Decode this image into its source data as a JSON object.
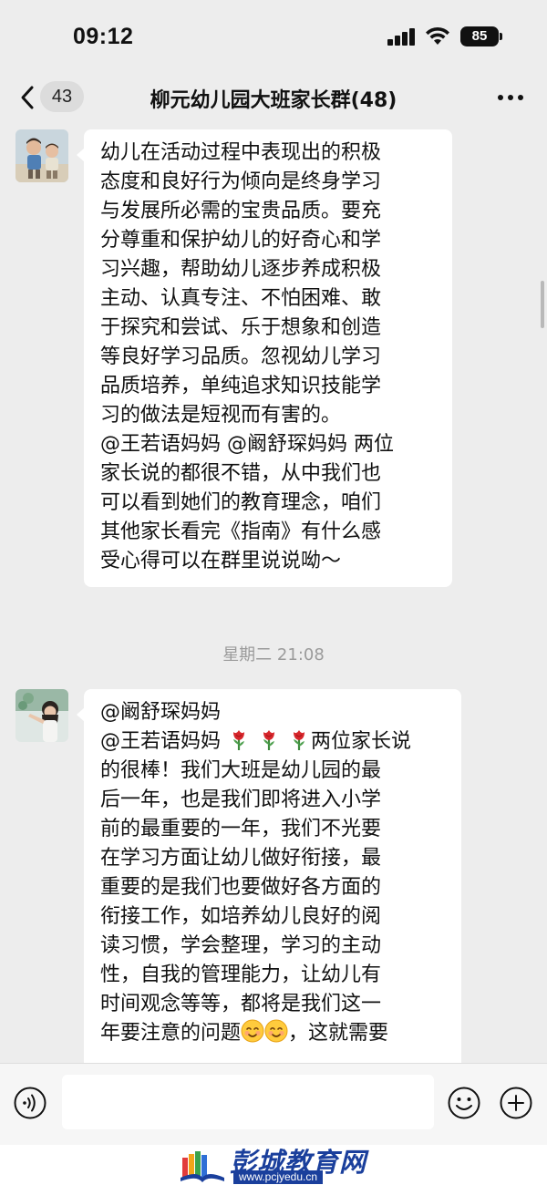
{
  "status_bar": {
    "time": "09:12",
    "battery": "85"
  },
  "nav": {
    "unread_count": "43",
    "title": "柳元幼儿园大班家长群(48)"
  },
  "messages": [
    {
      "avatar": "avatar-boys-photo",
      "text": "幼儿在活动过程中表现出的积极\n态度和良好行为倾向是终身学习\n与发展所必需的宝贵品质。要充\n分尊重和保护幼儿的好奇心和学\n习兴趣，帮助幼儿逐步养成积极\n主动、认真专注、不怕困难、敢\n于探究和尝试、乐于想象和创造\n等良好学习品质。忽视幼儿学习\n品质培养，单纯追求知识技能学\n习的做法是短视而有害的。\n@王若语妈妈 @阚舒琛妈妈 两位\n家长说的都很不错，从中我们也\n可以看到她们的教育理念，咱们\n其他家长看完《指南》有什么感\n受心得可以在群里说说呦～"
    },
    {
      "avatar": "avatar-girl-photo",
      "line1": "@阚舒琛妈妈",
      "line2_before": "@王若语妈妈 ",
      "line2_after": "两位家长说",
      "text_rest": "的很棒！我们大班是幼儿园的最\n后一年，也是我们即将进入小学\n前的最重要的一年，我们不光要\n在学习方面让幼儿做好衔接，最\n重要的是我们也要做好各方面的\n衔接工作，如培养幼儿良好的阅\n读习惯，学会整理，学习的主动\n性，自我的管理能力，让幼儿有\n时间观念等等，都将是我们这一",
      "last_line_before": "年要注意的问题",
      "last_line_after": "，这就需要",
      "emojis_rose": [
        "rose-icon",
        "rose-icon",
        "rose-icon"
      ],
      "emojis_smile": [
        "smile-icon",
        "smile-icon"
      ]
    }
  ],
  "timestamp": "星期二 21:08",
  "input": {
    "placeholder": ""
  },
  "watermark": {
    "name": "彭城教育网",
    "url": "www.pcjyedu.cn"
  },
  "colors": {
    "background": "#ededed",
    "bubble": "#ffffff",
    "watermark_blue": "#1a3f9c"
  }
}
